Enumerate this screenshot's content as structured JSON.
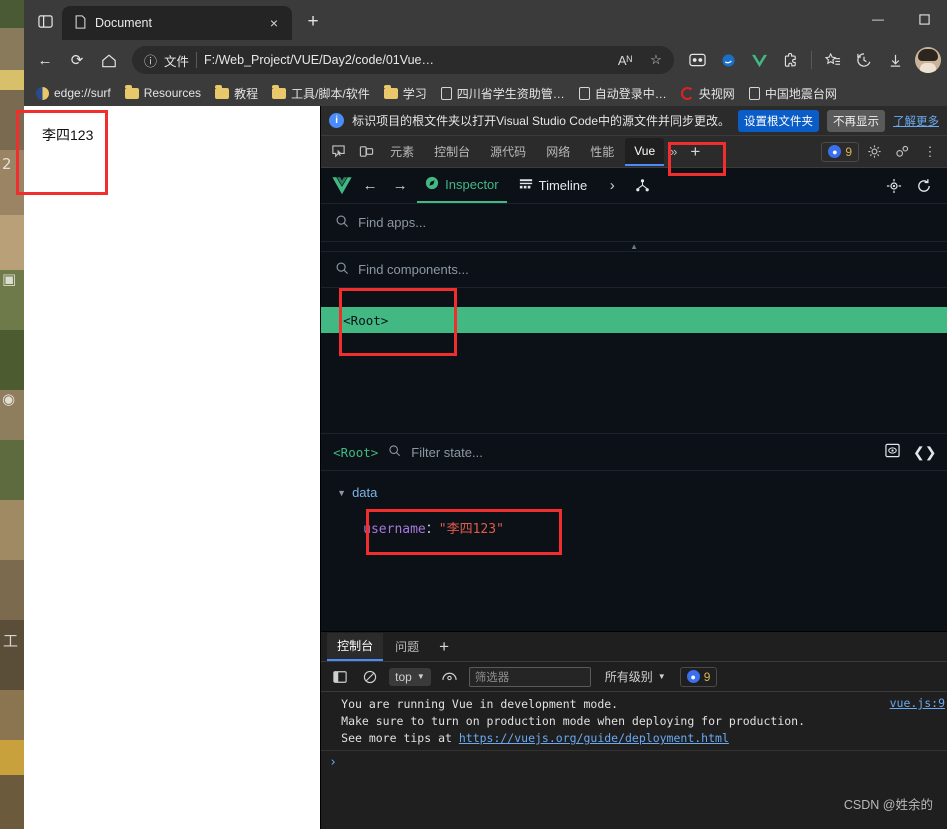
{
  "browser": {
    "tab": {
      "title": "Document",
      "close_label": "×",
      "page_icon": "page-icon"
    },
    "new_tab_label": "+",
    "window_controls": {
      "minimize": "—",
      "maximize": "☐",
      "close": "×"
    },
    "toolbar": {
      "back": "←",
      "reload": "⟳",
      "home": "⌂",
      "omnibox": {
        "info_icon": "ⓘ",
        "scheme_label": "文件",
        "url": "F:/Web_Project/VUE/Day2/code/01Vue…",
        "read_aloud": "Aᴺ",
        "favorite": "☆"
      },
      "right_icons": [
        "collections-icon",
        "edge-copilot-icon",
        "vue-devtools-icon",
        "extensions-icon",
        "favorites-icon",
        "history-icon",
        "downloads-icon"
      ]
    },
    "bookmarks": [
      {
        "label": "edge://surf",
        "icon": "edge-surf-icon"
      },
      {
        "label": "Resources",
        "icon": "folder-icon"
      },
      {
        "label": "教程",
        "icon": "folder-icon"
      },
      {
        "label": "工具/脚本/软件",
        "icon": "folder-icon"
      },
      {
        "label": "学习",
        "icon": "folder-icon"
      },
      {
        "label": "四川省学生资助管…",
        "icon": "page-icon"
      },
      {
        "label": "自动登录中…",
        "icon": "page-icon"
      },
      {
        "label": "央视网",
        "icon": "cctv-icon"
      },
      {
        "label": "中国地震台网",
        "icon": "page-icon"
      }
    ]
  },
  "page": {
    "input_value": "李四123"
  },
  "devtools": {
    "notice": {
      "text": "标识项目的根文件夹以打开Visual Studio Code中的源文件并同步更改。",
      "primary_button": "设置根文件夹",
      "secondary_button": "不再显示",
      "learn_more": "了解更多"
    },
    "tabs": [
      {
        "label": "元素",
        "active": false
      },
      {
        "label": "控制台",
        "active": false
      },
      {
        "label": "源代码",
        "active": false
      },
      {
        "label": "网络",
        "active": false
      },
      {
        "label": "性能",
        "active": false
      },
      {
        "label": "Vue",
        "active": true
      }
    ],
    "overflow_label": "»",
    "add_tab_label": "+",
    "message_badge": {
      "count": "9"
    },
    "right_icons": [
      "settings-gear-icon",
      "customize-icon",
      "more-icon"
    ]
  },
  "vue": {
    "tabs": [
      {
        "label": "Inspector",
        "active": true,
        "icon": "compass-icon"
      },
      {
        "label": "Timeline",
        "active": false,
        "icon": "timeline-icon"
      }
    ],
    "overflow_label": "›",
    "extra_icon": "hierarchy-icon",
    "app_search_placeholder": "Find apps...",
    "component_search_placeholder": "Find components...",
    "tree": [
      {
        "label": "<Root>",
        "selected": true
      }
    ],
    "state": {
      "root_tag": "<Root>",
      "filter_placeholder": "Filter state...",
      "group": "data",
      "props": [
        {
          "key": "username",
          "colon": "：",
          "value": "\"李四123\""
        }
      ],
      "right_icons": [
        "inspect-dom-icon",
        "open-in-editor-icon"
      ]
    },
    "nav": {
      "back": "←",
      "forward": "→"
    },
    "head_icons": [
      "select-component-icon",
      "refresh-icon"
    ]
  },
  "console": {
    "tabs": [
      {
        "label": "控制台",
        "active": true
      },
      {
        "label": "问题",
        "active": false
      }
    ],
    "add_tab_label": "+",
    "toolbar": {
      "sidebar_icon": "show-sidebar-icon",
      "clear_icon": "clear-console-icon",
      "context": "top",
      "context_caret": "▼",
      "eye_icon": "live-expression-icon",
      "filter_placeholder": "筛选器",
      "level": "所有级别",
      "level_caret": "▼",
      "badge_count": "9"
    },
    "messages": [
      {
        "text": "You are running Vue in development mode.",
        "source": "vue.js:9"
      },
      {
        "text": "Make sure to turn on production mode when deploying for production."
      }
    ],
    "tip_prefix": "See more tips at ",
    "tip_link": "https://vuejs.org/guide/deployment.html",
    "prompt": "›"
  },
  "watermark": "CSDN @姓余的",
  "annotation_color": "#f22d2d"
}
